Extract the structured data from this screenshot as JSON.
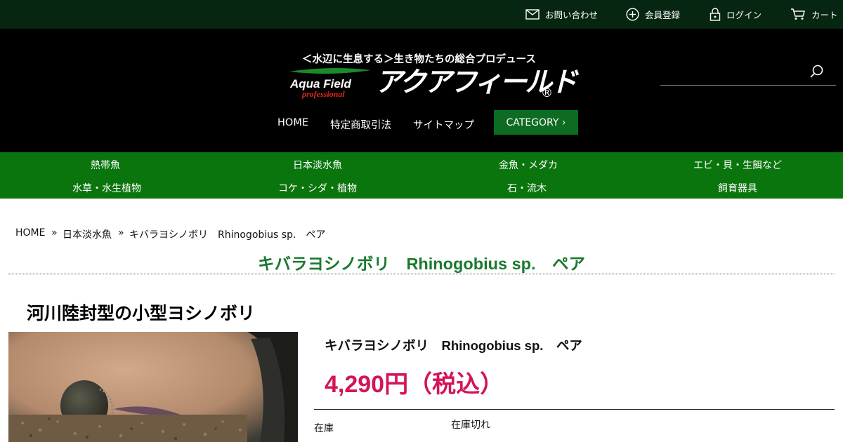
{
  "utility_nav": {
    "contact": "お問い合わせ",
    "register": "会員登録",
    "login": "ログイン",
    "cart": "カート"
  },
  "header": {
    "tagline": "＜水辺に生息する＞生き物たちの総合プロデュース",
    "logo_en_1": "Aqua Field",
    "logo_en_2": "professional",
    "logo_kana": "アクアフィールド",
    "logo_reg": "®"
  },
  "main_nav": {
    "home": "HOME",
    "law": "特定商取引法",
    "sitemap": "サイトマップ",
    "category": "CATEGORY ›"
  },
  "categories": [
    "熱帯魚",
    "日本淡水魚",
    "金魚・メダカ",
    "エビ・貝・生餌など",
    "水草・水生植物",
    "コケ・シダ・植物",
    "石・流木",
    "飼育器具"
  ],
  "breadcrumb": {
    "home": "HOME",
    "sep": "»",
    "category": "日本淡水魚",
    "current": "キバラヨシノボリ　Rhinogobius sp.　ペア"
  },
  "product": {
    "page_title": "キバラヨシノボリ　Rhinogobius sp.　ペア",
    "subheading": "河川陸封型の小型ヨシノボリ",
    "name": "キバラヨシノボリ　Rhinogobius sp.　ペア",
    "price": "4,290円（税込）",
    "stock_label": "在庫",
    "stock_value": "在庫切れ"
  },
  "colors": {
    "topbar": "#062612",
    "header": "#000000",
    "category_band": "#0a750d",
    "category_button": "#0d6b22",
    "title_green": "#1a7a2e",
    "price": "#d4145a"
  }
}
